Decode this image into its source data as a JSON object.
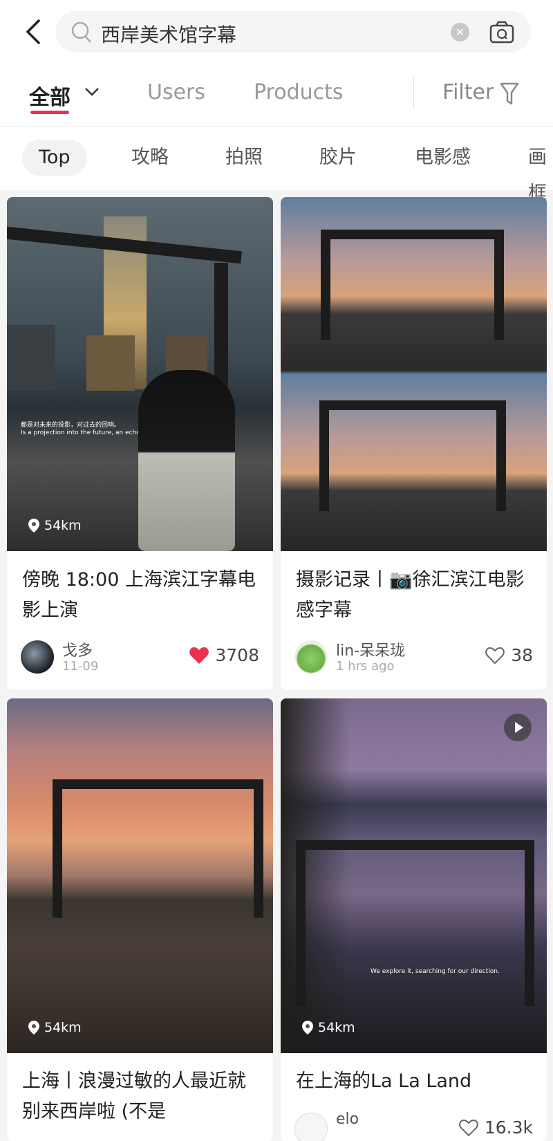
{
  "search": {
    "query": "西岸美术馆字幕",
    "back_icon": "chevron-left-icon",
    "search_icon": "magnifier-icon",
    "clear_icon": "clear-x-icon",
    "camera_icon": "camera-search-icon"
  },
  "tabs": {
    "items": [
      {
        "label": "全部",
        "active": true
      },
      {
        "label": "Users"
      },
      {
        "label": "Products"
      }
    ],
    "filter_label": "Filter",
    "accent": "#e8324d"
  },
  "chips": [
    {
      "label": "Top",
      "active": true
    },
    {
      "label": "攻略"
    },
    {
      "label": "拍照"
    },
    {
      "label": "胶片"
    },
    {
      "label": "电影感"
    },
    {
      "label": "画框"
    }
  ],
  "cards": [
    {
      "title": "傍晚 18:00 上海滨江字幕电影上演",
      "distance": "54km",
      "author": "戈多",
      "time": "11-09",
      "likes": "3708",
      "liked": true,
      "subtitle_cn": "都是对未来的投影，对过去的回响。",
      "subtitle_en": "Is a projection into the future, an echo of the past."
    },
    {
      "title": "摄影记录丨📷徐汇滨江电影感字幕",
      "author": "lin-呆呆珑",
      "time": "1 hrs ago",
      "likes": "38",
      "liked": false
    },
    {
      "title": "上海丨浪漫过敏的人最近就别来西岸啦 (不是",
      "distance": "54km"
    },
    {
      "title": "在上海的La La Land",
      "distance": "54km",
      "author": "elo",
      "likes": "16.3k",
      "video": true,
      "subtitle_en": "We explore it, searching for our direction."
    }
  ],
  "colors": {
    "like_red": "#e8324d"
  }
}
